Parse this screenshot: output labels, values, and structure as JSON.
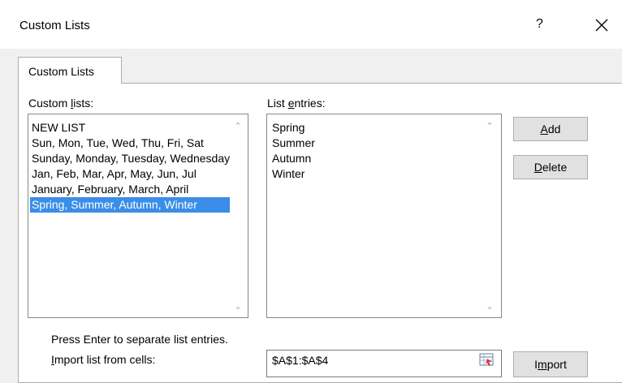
{
  "window": {
    "title": "Custom Lists",
    "help_label": "?",
    "close_icon": "close-icon"
  },
  "tab": {
    "label": "Custom Lists"
  },
  "custom_lists": {
    "label_pre": "Custom ",
    "label_key": "l",
    "label_post": "ists:",
    "items": [
      "NEW LIST",
      "Sun, Mon, Tue, Wed, Thu, Fri, Sat",
      "Sunday, Monday, Tuesday, Wednesday",
      "Jan, Feb, Mar, Apr, May, Jun, Jul",
      "January, February, March, April",
      "Spring, Summer, Autumn, Winter"
    ],
    "selected_index": 5
  },
  "list_entries": {
    "label_pre": "List ",
    "label_key": "e",
    "label_post": "ntries:",
    "items": [
      "Spring",
      "Summer",
      "Autumn",
      "Winter"
    ]
  },
  "buttons": {
    "add_key": "A",
    "add_rest": "dd",
    "delete_key": "D",
    "delete_rest": "elete",
    "import_pre": "I",
    "import_key": "m",
    "import_rest": "port"
  },
  "hint": "Press Enter to separate list entries.",
  "import": {
    "label_key": "I",
    "label_rest": "mport list from cells:",
    "value": "$A$1:$A$4"
  }
}
